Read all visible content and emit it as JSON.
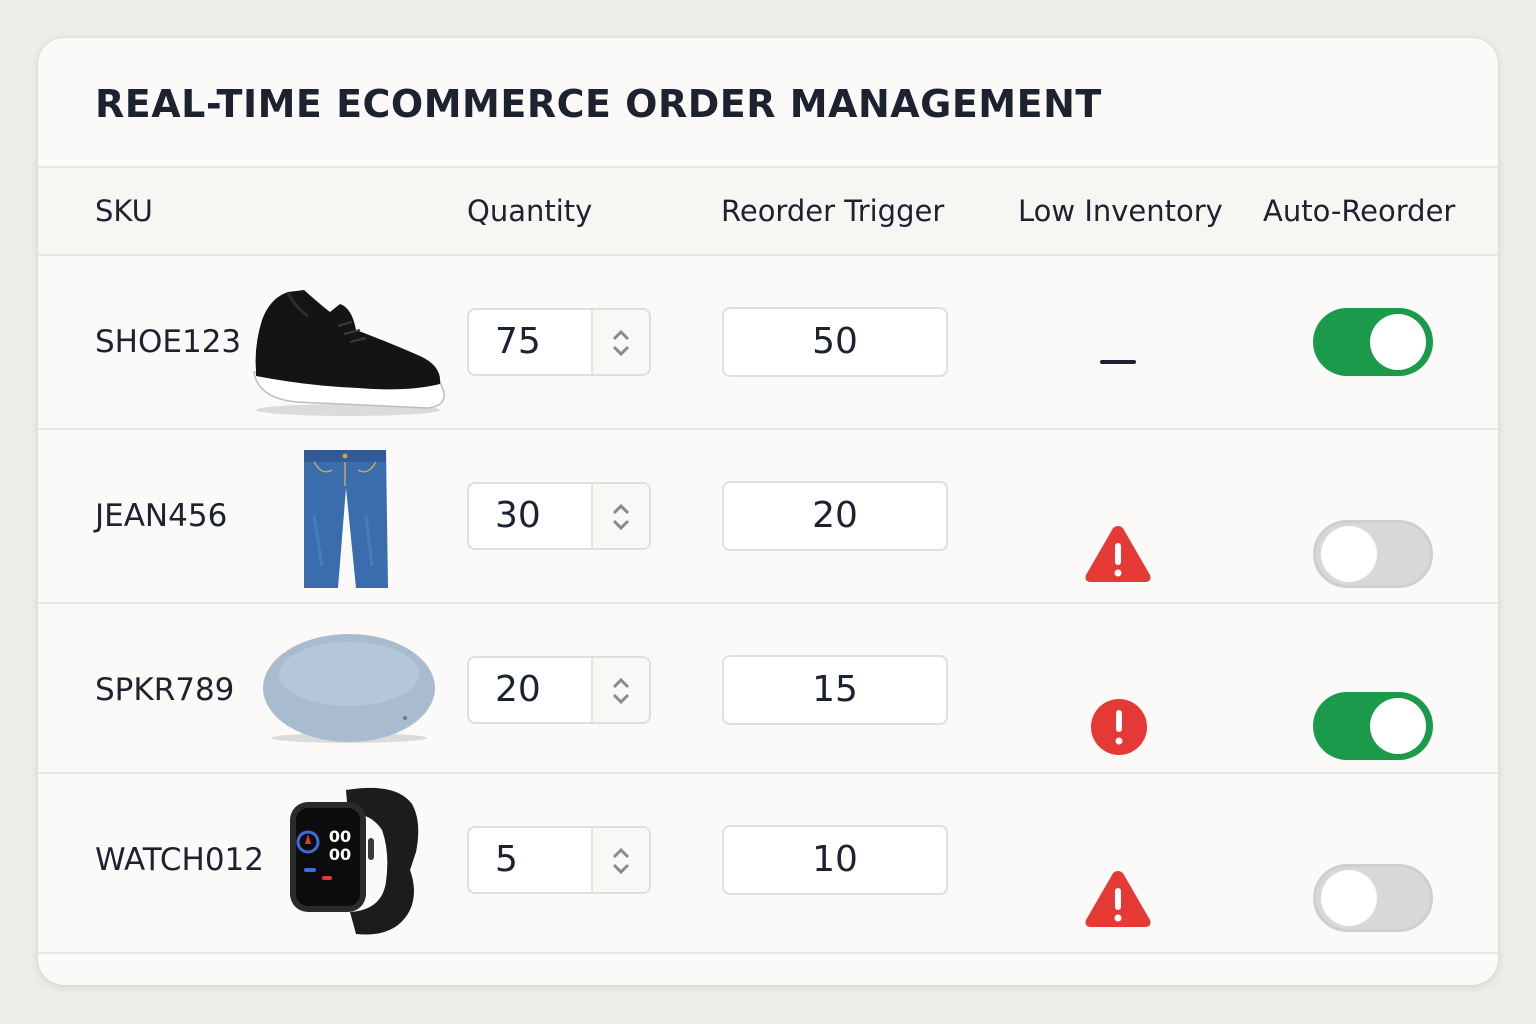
{
  "page": {
    "title": "REAL-TIME ECOMMERCE ORDER MANAGEMENT"
  },
  "columns": {
    "sku": "SKU",
    "quantity": "Quantity",
    "reorder_trigger": "Reorder Trigger",
    "low_inventory": "Low Inventory",
    "auto_reorder": "Auto-Reorder"
  },
  "rows": [
    {
      "sku": "SHOE123",
      "image": "sneaker-image",
      "quantity": "75",
      "reorder_trigger": "50",
      "low_inventory": "—",
      "low_inventory_icon": "dash-icon",
      "auto_reorder": true
    },
    {
      "sku": "JEAN456",
      "image": "jeans-image",
      "quantity": "30",
      "reorder_trigger": "20",
      "low_inventory_icon": "warning-triangle-icon",
      "auto_reorder": false
    },
    {
      "sku": "SPKR789",
      "image": "smart-speaker-image",
      "quantity": "20",
      "reorder_trigger": "15",
      "low_inventory_icon": "alert-circle-icon",
      "auto_reorder": true
    },
    {
      "sku": "WATCH012",
      "image": "smartwatch-image",
      "quantity": "5",
      "reorder_trigger": "10",
      "low_inventory_icon": "warning-triangle-icon",
      "auto_reorder": false
    }
  ],
  "watch_face": {
    "top": "00",
    "bottom": "00"
  },
  "colors": {
    "toggle_on": "#1b9a4c",
    "toggle_off": "#d8d8d8",
    "alert_red": "#e53935",
    "text": "#1d2230"
  }
}
